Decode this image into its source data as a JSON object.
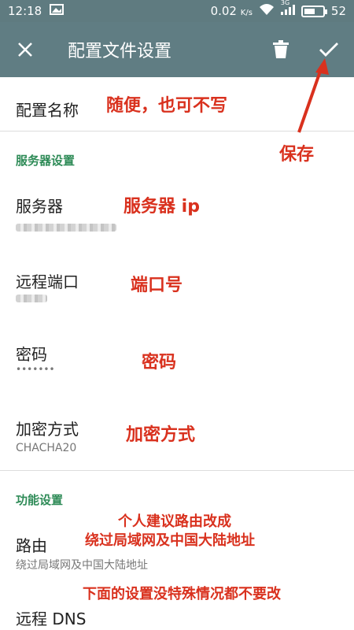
{
  "status_bar": {
    "time": "12:18",
    "speed": "0.02",
    "speed_unit": "K/s",
    "network": "3G",
    "battery": "52",
    "battery_level": 0.52
  },
  "app_bar": {
    "title": "配置文件设置"
  },
  "profile_name": {
    "label": "配置名称",
    "note": "随便，也可不写"
  },
  "save_note": "保存",
  "server_section": {
    "header": "服务器设置",
    "server": {
      "label": "服务器",
      "note": "服务器 ip"
    },
    "port": {
      "label": "远程端口",
      "note": "端口号"
    },
    "password": {
      "label": "密码",
      "value": "•••••••",
      "note": "密码"
    },
    "encryption": {
      "label": "加密方式",
      "value": "CHACHA20",
      "note": "加密方式"
    }
  },
  "feature_section": {
    "header": "功能设置",
    "route": {
      "label": "路由",
      "value": "绕过局域网及中国大陆地址",
      "note_line1": "个人建议路由改成",
      "note_line2": "绕过局域网及中国大陆地址"
    },
    "bottom_note": "下面的设置没特殊情况都不要改",
    "remote_dns": {
      "label": "远程 DNS"
    }
  },
  "colors": {
    "app_bar": "#607d83",
    "status_bar": "#5f7b80",
    "section_header": "#2e8b57",
    "annotation": "#d9311e"
  }
}
